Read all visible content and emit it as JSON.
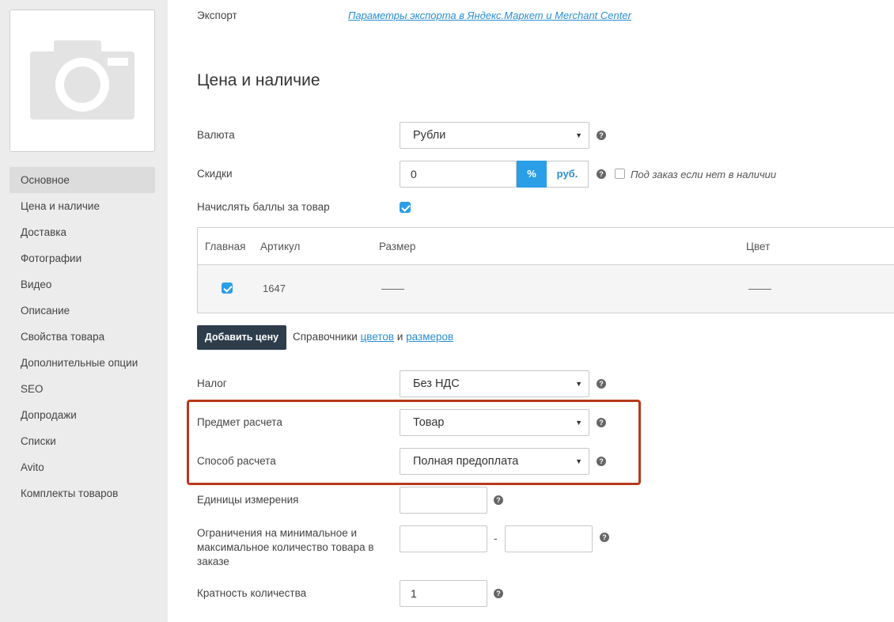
{
  "sidebar": {
    "items": [
      {
        "label": "Основное",
        "active": true
      },
      {
        "label": "Цена и наличие"
      },
      {
        "label": "Доставка"
      },
      {
        "label": "Фотографии"
      },
      {
        "label": "Видео"
      },
      {
        "label": "Описание"
      },
      {
        "label": "Свойства товара"
      },
      {
        "label": "Дополнительные опции"
      },
      {
        "label": "SEO"
      },
      {
        "label": "Допродажи"
      },
      {
        "label": "Списки"
      },
      {
        "label": "Avito"
      },
      {
        "label": "Комплекты товаров"
      }
    ]
  },
  "export": {
    "label": "Экспорт",
    "link": "Параметры экспорта в Яндекс.Маркет и Merchant Center"
  },
  "section_title": "Цена и наличие",
  "currency": {
    "label": "Валюта",
    "value": "Рубли"
  },
  "discounts": {
    "label": "Скидки",
    "value": "0",
    "percent": "%",
    "rub": "руб.",
    "preorder_label": "Под заказ если нет в наличии"
  },
  "points": {
    "label": "Начислять баллы за товар",
    "checked": true
  },
  "table": {
    "headers": [
      "Главная",
      "Артикул",
      "Размер",
      "Цвет"
    ],
    "rows": [
      {
        "main": true,
        "article": "1647",
        "size": "––––",
        "color": "––––"
      }
    ]
  },
  "add_price": {
    "button": "Добавить цену",
    "text_before": "Справочники",
    "colors_link": "цветов",
    "and": "и",
    "sizes_link": "размеров"
  },
  "tax": {
    "label": "Налог",
    "value": "Без НДС"
  },
  "subject": {
    "label": "Предмет расчета",
    "value": "Товар"
  },
  "method": {
    "label": "Способ расчета",
    "value": "Полная предоплата"
  },
  "units": {
    "label": "Единицы измерения",
    "value": ""
  },
  "limits": {
    "line1": "Ограничения на минимальное и",
    "line2": "максимальное количество товара в",
    "line3": "заказе",
    "separator": "-",
    "min": "",
    "max": ""
  },
  "multiplicity": {
    "label": "Кратность количества",
    "value": "1"
  },
  "colors": {
    "accent": "#2a9ee6",
    "highlight": "#b7391b",
    "button_dark": "#2e3d4c"
  }
}
